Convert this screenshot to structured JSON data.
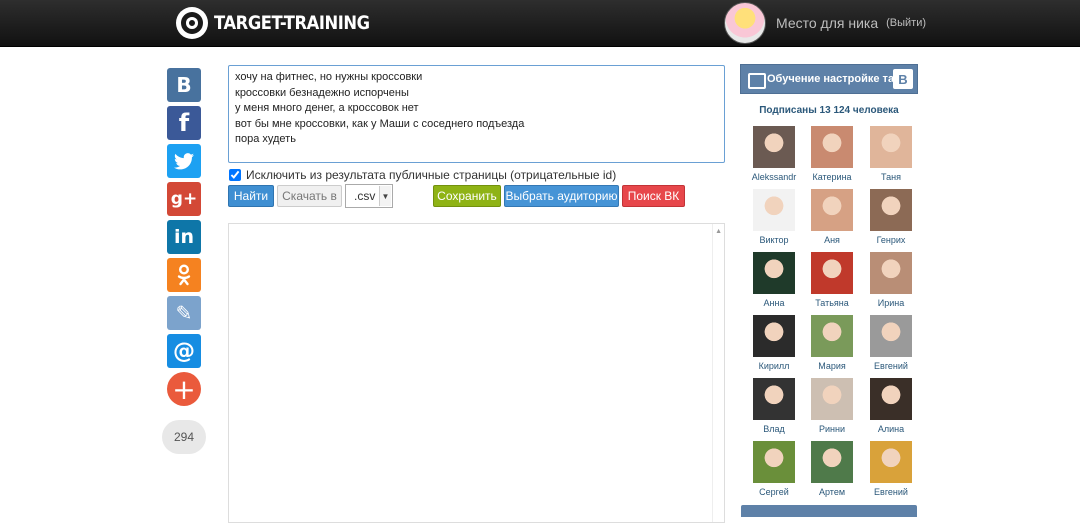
{
  "header": {
    "logo_text": "TARGET-TRAINING",
    "nick": "Место для ника",
    "logout": "(Выйти)"
  },
  "social": {
    "buttons": [
      {
        "id": "vk",
        "glyph": "В",
        "icon": "vk-icon"
      },
      {
        "id": "fb",
        "glyph": "f",
        "icon": "facebook-icon"
      },
      {
        "id": "tw",
        "glyph": "🐦",
        "icon": "twitter-icon"
      },
      {
        "id": "gp",
        "glyph": "g+",
        "icon": "google-plus-icon"
      },
      {
        "id": "in",
        "glyph": "in",
        "icon": "linkedin-icon"
      },
      {
        "id": "ok",
        "glyph": "ок",
        "icon": "odnoklassniki-icon"
      },
      {
        "id": "lj",
        "glyph": "✎",
        "icon": "livejournal-icon"
      },
      {
        "id": "ml",
        "glyph": "@",
        "icon": "mail-icon"
      },
      {
        "id": "plus",
        "glyph": "+",
        "icon": "plus-icon"
      }
    ],
    "count": "294"
  },
  "query": {
    "lines": [
      "хочу на фитнес, но нужны кроссовки",
      "кроссовки безнадежно испорчены",
      "у меня много денег, а кроссовок нет",
      "вот бы мне кроссовки, как у Маши с соседнего подъезда",
      "пора худеть"
    ]
  },
  "exclude_label": "Исключить из результата публичные страницы (отрицательные id)",
  "buttons": {
    "find": "Найти",
    "download": "Скачать в",
    "format": ".csv",
    "save": "Сохранить",
    "audience": "Выбрать аудиторию",
    "vk_search": "Поиск ВК"
  },
  "widget": {
    "title": "Обучение настройке та...",
    "vk_badge": "В",
    "subscribers": "Подписаны 13 124 человека",
    "members": [
      {
        "name": "Alekssandr",
        "color": "#6b5a52"
      },
      {
        "name": "Катерина",
        "color": "#c98a70"
      },
      {
        "name": "Таня",
        "color": "#e0b59a"
      },
      {
        "name": "Виктор",
        "color": "#f2f2f2"
      },
      {
        "name": "Аня",
        "color": "#d6a184"
      },
      {
        "name": "Генрих",
        "color": "#8c6a55"
      },
      {
        "name": "Анна",
        "color": "#1f3a2a"
      },
      {
        "name": "Татьяна",
        "color": "#c0392b"
      },
      {
        "name": "Ирина",
        "color": "#b98e76"
      },
      {
        "name": "Кирилл",
        "color": "#2b2b2b"
      },
      {
        "name": "Мария",
        "color": "#7a9a5a"
      },
      {
        "name": "Евгений",
        "color": "#9a9a9a"
      },
      {
        "name": "Влад",
        "color": "#333333"
      },
      {
        "name": "Ринни",
        "color": "#cdbfb2"
      },
      {
        "name": "Алина",
        "color": "#3a2f28"
      },
      {
        "name": "Сергей",
        "color": "#6a8f3a"
      },
      {
        "name": "Артем",
        "color": "#4f7a4a"
      },
      {
        "name": "Евгений",
        "color": "#d9a23a"
      }
    ]
  }
}
